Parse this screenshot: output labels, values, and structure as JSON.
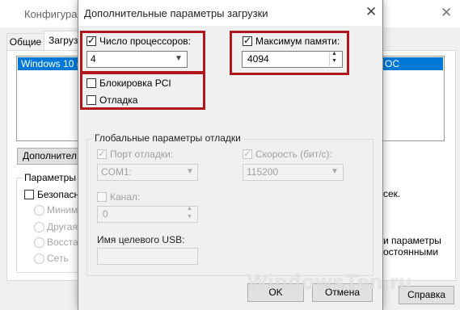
{
  "background_window": {
    "title": "Конфигурац",
    "tabs": [
      "Общие",
      "Загрузк"
    ],
    "boot_list": {
      "selected_left": "Windows 10 (C",
      "selected_right": "ОС"
    },
    "advanced_button": "Дополнител",
    "boot_options_group": "Параметры з",
    "safe_boot_label": "Безопасн",
    "radio_options": [
      "Минима",
      "Другая",
      "Восстан",
      "Сеть"
    ],
    "right_text": [
      "сек.",
      "и параметры",
      "остоянными"
    ],
    "help_button": "Справка"
  },
  "dialog": {
    "title": "Дополнительные параметры загрузки",
    "num_processors": {
      "label": "Число процессоров:",
      "checked": true,
      "value": "4"
    },
    "max_memory": {
      "label": "Максимум памяти:",
      "checked": true,
      "value": "4094"
    },
    "pci_lock": {
      "label": "Блокировка PCI",
      "checked": false
    },
    "debug": {
      "label": "Отладка",
      "checked": false
    },
    "global_debug": {
      "group_label": "Глобальные параметры отладки",
      "debug_port": {
        "label": "Порт отладки:",
        "checked": true,
        "value": "COM1:"
      },
      "baud_rate": {
        "label": "Скорость (бит/с):",
        "checked": true,
        "value": "115200"
      },
      "channel": {
        "label": "Канал:",
        "checked": false,
        "value": "0"
      },
      "usb_target": {
        "label": "Имя целевого USB:",
        "value": ""
      }
    },
    "ok_button": "OK",
    "cancel_button": "Отмена"
  },
  "watermark": "WindowsTen.ru",
  "colors": {
    "highlight": "#b0161c",
    "selection": "#0078d7"
  }
}
